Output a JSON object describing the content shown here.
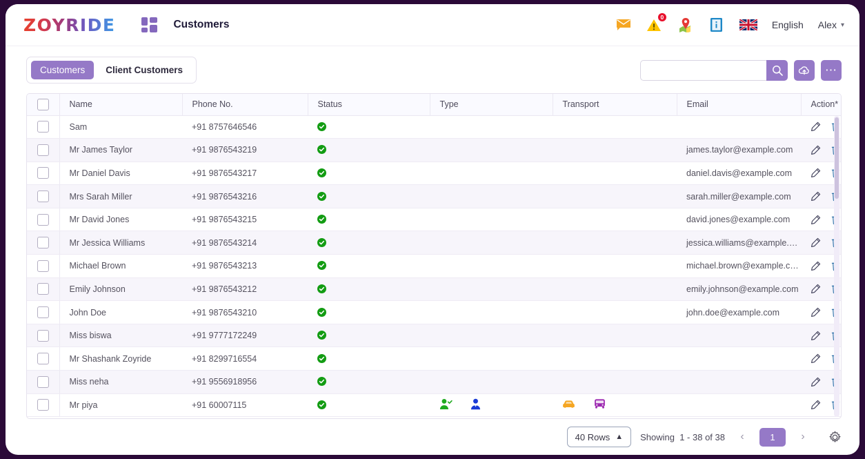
{
  "brand": {
    "name": "ZOYRIDE",
    "accent": "#9579c7",
    "dark_bg": "#2b0a38"
  },
  "header": {
    "page_title": "Customers",
    "apps_icon": "grid-apps-icon",
    "icons": [
      {
        "name": "messages-icon",
        "glyph": "envelope",
        "color": "#f5a623"
      },
      {
        "name": "alerts-icon",
        "glyph": "warning-triangle",
        "color": "#ffc400",
        "badge": "0"
      },
      {
        "name": "map-icon",
        "glyph": "map-pin",
        "color": "#e53935"
      },
      {
        "name": "info-icon",
        "glyph": "info-book",
        "color": "#1e88c7"
      }
    ],
    "language": "English",
    "language_flag": "uk-flag-icon",
    "user": "Alex"
  },
  "toolbar": {
    "tabs": [
      {
        "label": "Customers",
        "active": true
      },
      {
        "label": "Client Customers",
        "active": false
      }
    ],
    "search": {
      "value": "",
      "placeholder": ""
    },
    "search_icon": "search-icon",
    "upload_icon": "cloud-upload-icon",
    "more_icon": "more-options-icon"
  },
  "table": {
    "columns": [
      "Name",
      "Phone No.",
      "Status",
      "Type",
      "Transport",
      "Email",
      "Action*"
    ],
    "rows": [
      {
        "name": "Sam",
        "phone": "+91 8757646546",
        "status": "active",
        "type": [],
        "transport": [],
        "email": ""
      },
      {
        "name": "Mr James Taylor",
        "phone": "+91 9876543219",
        "status": "active",
        "type": [],
        "transport": [],
        "email": "james.taylor@example.com"
      },
      {
        "name": "Mr Daniel Davis",
        "phone": "+91 9876543217",
        "status": "active",
        "type": [],
        "transport": [],
        "email": "daniel.davis@example.com"
      },
      {
        "name": "Mrs Sarah Miller",
        "phone": "+91 9876543216",
        "status": "active",
        "type": [],
        "transport": [],
        "email": "sarah.miller@example.com"
      },
      {
        "name": "Mr David Jones",
        "phone": "+91 9876543215",
        "status": "active",
        "type": [],
        "transport": [],
        "email": "david.jones@example.com"
      },
      {
        "name": "Mr Jessica Williams",
        "phone": "+91 9876543214",
        "status": "active",
        "type": [],
        "transport": [],
        "email": "jessica.williams@example.com"
      },
      {
        "name": "Michael Brown",
        "phone": "+91 9876543213",
        "status": "active",
        "type": [],
        "transport": [],
        "email": "michael.brown@example.com"
      },
      {
        "name": "Emily Johnson",
        "phone": "+91 9876543212",
        "status": "active",
        "type": [],
        "transport": [],
        "email": "emily.johnson@example.com"
      },
      {
        "name": "John Doe",
        "phone": "+91 9876543210",
        "status": "active",
        "type": [],
        "transport": [],
        "email": "john.doe@example.com"
      },
      {
        "name": "Miss biswa",
        "phone": "+91 9777172249",
        "status": "active",
        "type": [],
        "transport": [],
        "email": ""
      },
      {
        "name": "Mr Shashank Zoyride",
        "phone": "+91 8299716554",
        "status": "active",
        "type": [],
        "transport": [],
        "email": ""
      },
      {
        "name": "Miss neha",
        "phone": "+91 9556918956",
        "status": "active",
        "type": [],
        "transport": [],
        "email": ""
      },
      {
        "name": "Mr piya",
        "phone": "+91 60007115",
        "status": "active",
        "type": [
          "verified-user",
          "business-user"
        ],
        "transport": [
          "car",
          "bus"
        ],
        "email": ""
      }
    ],
    "action_icons": [
      "edit-pencil-icon",
      "delete-trash-icon"
    ]
  },
  "footer": {
    "rows_per_page": "40 Rows",
    "showing_label": "Showing",
    "showing_range": "1 - 38 of 38",
    "prev_label": "‹",
    "next_label": "›",
    "current_page": "1",
    "settings_icon": "settings-gear-icon"
  }
}
